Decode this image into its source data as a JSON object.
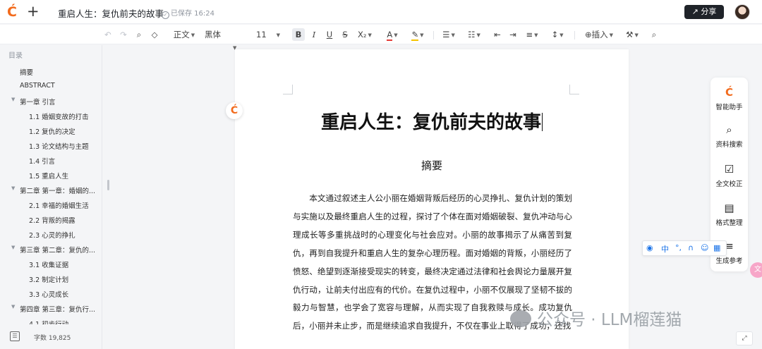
{
  "header": {
    "doc_title": "重启人生：复仇前夫的故事",
    "saved_status": "已保存 16:24",
    "share_label": "分享",
    "new_label": "+"
  },
  "toolbar": {
    "style": "正文",
    "font": "黑体",
    "size": "11",
    "bold": "B",
    "italic": "I",
    "underline": "U",
    "strike": "S",
    "subscript": "X₂",
    "font_color": "A",
    "insert": "插入"
  },
  "sidebar": {
    "title": "目录",
    "items": [
      {
        "label": "摘要"
      },
      {
        "label": "ABSTRACT"
      },
      {
        "label": "第一章 引言"
      },
      {
        "label": "1.1 婚姻变故的打击"
      },
      {
        "label": "1.2 复仇的决定"
      },
      {
        "label": "1.3 论文结构与主题"
      },
      {
        "label": "1.4 引言"
      },
      {
        "label": "1.5 重启人生"
      },
      {
        "label": "第二章 第一章：婚姻的..."
      },
      {
        "label": "2.1 幸福的婚姻生活"
      },
      {
        "label": "2.2 背叛的揭露"
      },
      {
        "label": "2.3 心灵的挣扎"
      },
      {
        "label": "第三章 第二章：复仇的..."
      },
      {
        "label": "3.1 收集证据"
      },
      {
        "label": "3.2 制定计划"
      },
      {
        "label": "3.3 心灵成长"
      },
      {
        "label": "第四章 第三章：复仇行..."
      },
      {
        "label": "4.1 初步行动"
      }
    ],
    "word_count": "字数 19,825"
  },
  "document": {
    "title": "重启人生：复仇前夫的故事",
    "abstract_heading": "摘要",
    "abstract_text": "本文通过叙述主人公小丽在婚姻背叛后经历的心灵挣扎、复仇计划的策划与实施以及最终重启人生的过程，探讨了个体在面对婚姻破裂、复仇冲动与心理成长等多重挑战时的心理变化与社会应对。小丽的故事揭示了从痛苦到复仇，再到自我提升和重启人生的复杂心理历程。面对婚姻的背叛，小丽经历了愤怒、绝望到逐渐接受现实的转变，最终决定通过法律和社会舆论力量展开复仇行动，让前夫付出应有的代价。在复仇过程中，小丽不仅展现了坚韧不拔的毅力与智慧，也学会了宽容与理解，从而实现了自我救赎与成长。成功复仇后，小丽并未止步，而是继续追求自我提升，不仅在事业上取得了成功，还找"
  },
  "right_panel": {
    "items": [
      {
        "label": "智能助手",
        "icon": "C"
      },
      {
        "label": "资料搜索",
        "icon": "⌕"
      },
      {
        "label": "全文校正",
        "icon": "✓"
      },
      {
        "label": "格式整理",
        "icon": "▤"
      },
      {
        "label": "生成参考",
        "icon": "≡"
      }
    ]
  },
  "ime": {
    "mode": "中"
  },
  "watermark": "公众号 · LLM榴莲猫",
  "colors": {
    "accent": "#f26b1d",
    "share_bg": "#1f2329"
  }
}
